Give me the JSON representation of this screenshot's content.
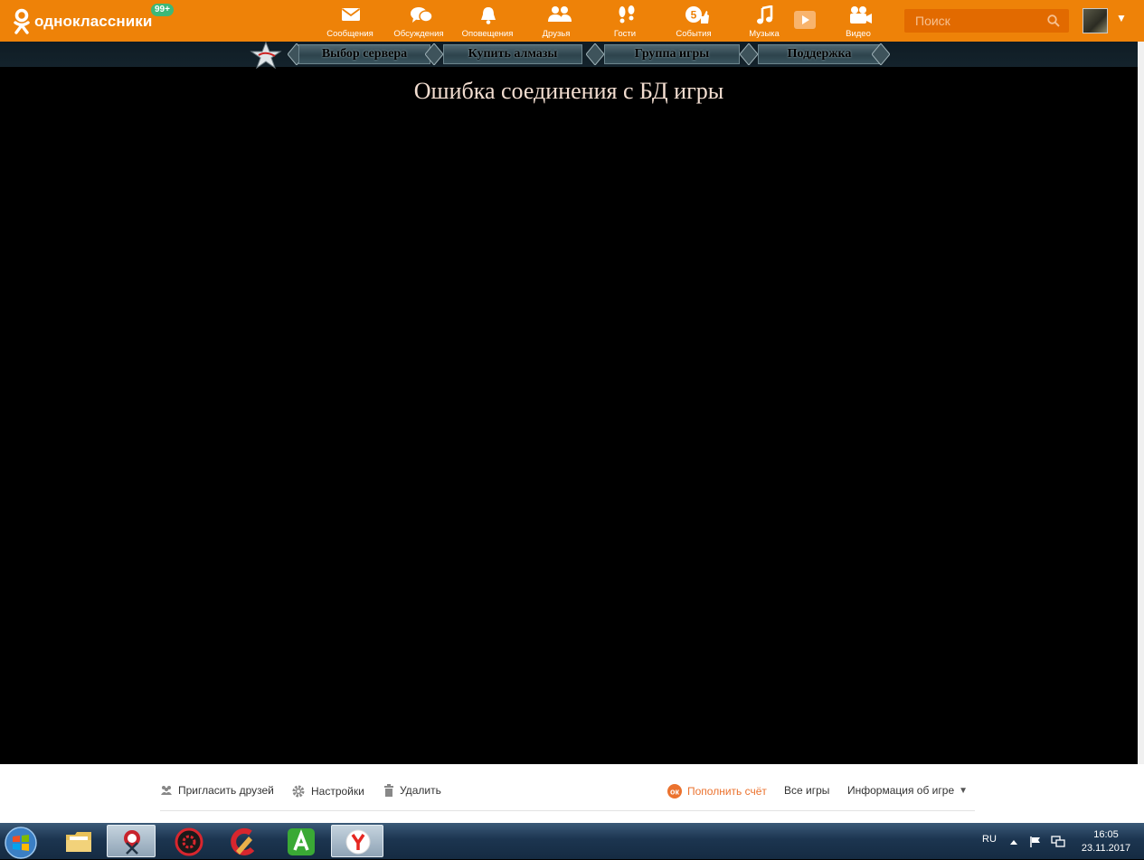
{
  "header": {
    "logo_text": "одноклассники",
    "badge": "99+",
    "search_placeholder": "Поиск",
    "nav": [
      {
        "id": "messages",
        "label": "Сообщения"
      },
      {
        "id": "discussions",
        "label": "Обсуждения"
      },
      {
        "id": "notifications",
        "label": "Оповещения"
      },
      {
        "id": "friends",
        "label": "Друзья"
      },
      {
        "id": "guests",
        "label": "Гости"
      },
      {
        "id": "events",
        "label": "События",
        "count": "5"
      },
      {
        "id": "music",
        "label": "Музыка"
      },
      {
        "id": "video",
        "label": "Видео"
      }
    ]
  },
  "game": {
    "menu": [
      "Выбор сервера",
      "Купить алмазы",
      "Группа игры",
      "Поддержка"
    ],
    "error_message": "Ошибка соединения с БД игры"
  },
  "footer": {
    "invite": "Пригласить друзей",
    "settings": "Настройки",
    "delete": "Удалить",
    "topup": "Пополнить счёт",
    "all_games": "Все игры",
    "game_info": "Информация об игре"
  },
  "taskbar": {
    "lang": "RU",
    "time": "16:05",
    "date": "23.11.2017"
  },
  "colors": {
    "ok_orange": "#ee8208",
    "accent": "#eb722e",
    "badge_green": "#3cb878"
  }
}
